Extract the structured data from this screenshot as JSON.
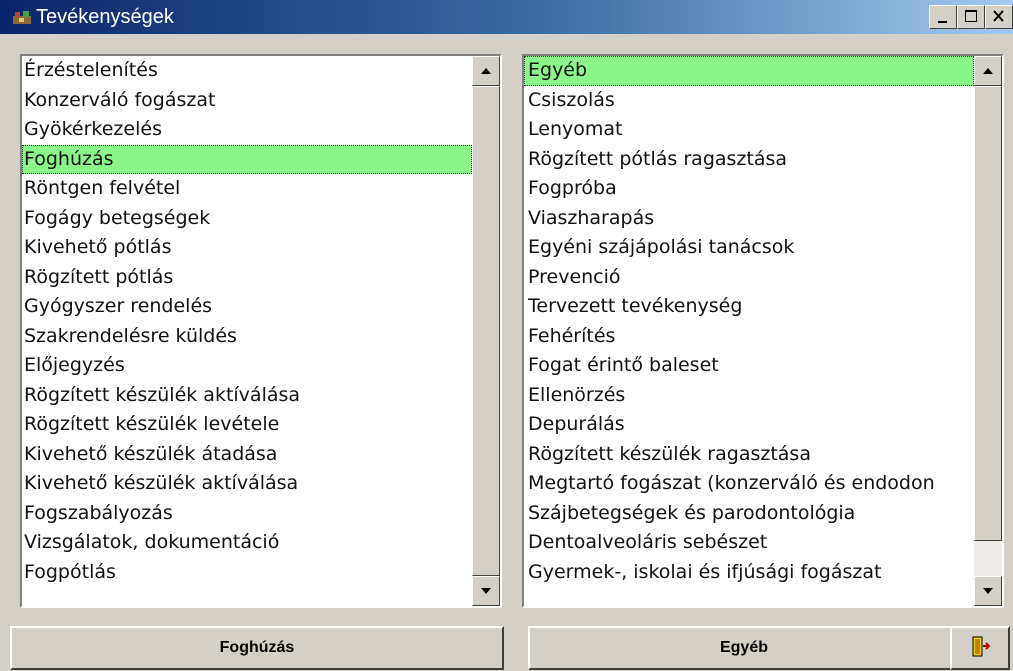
{
  "window": {
    "title": "Tevékenységek",
    "icon": "app-icon"
  },
  "title_buttons": {
    "minimize": "minimize-icon",
    "maximize": "maximize-icon",
    "close": "close-icon"
  },
  "left_list": {
    "items": [
      "Érzéstelenítés",
      "Konzerváló fogászat",
      "Gyökérkezelés",
      "Foghúzás",
      "Röntgen felvétel",
      "Fogágy betegségek",
      "Kivehető pótlás",
      "Rögzített pótlás",
      "Gyógyszer rendelés",
      "Szakrendelésre küldés",
      "Előjegyzés",
      "Rögzített készülék aktíválása",
      "Rögzített készülék levétele",
      "Kivehető készülék átadása",
      "Kivehető készülék aktíválása",
      "Fogszabályozás",
      "Vizsgálatok, dokumentáció",
      "Fogpótlás"
    ],
    "selected": "Foghúzás"
  },
  "right_list": {
    "items": [
      "Egyéb",
      "Csiszolás",
      "Lenyomat",
      "Rögzített pótlás ragasztása",
      "Fogpróba",
      "Viaszharapás",
      "Egyéni szájápolási tanácsok",
      "Prevenció",
      "Tervezett tevékenység",
      "Fehérítés",
      "Fogat érintő baleset",
      "Ellenörzés",
      "Depurálás",
      "Rögzített készülék ragasztása",
      "Megtartó fogászat (konzerváló és endodon",
      "Szájbetegségek és parodontológia",
      "Dentoalveoláris sebészet",
      "Gyermek-, iskolai és ifjúsági fogászat"
    ],
    "selected": "Egyéb"
  },
  "bottom": {
    "left_button": "Foghúzás",
    "right_button": "Egyéb",
    "exit_icon": "exit-door-icon"
  },
  "colors": {
    "selection": "#8bf78b",
    "titlebar_start": "#0a246a",
    "titlebar_end": "#a6caf0"
  }
}
